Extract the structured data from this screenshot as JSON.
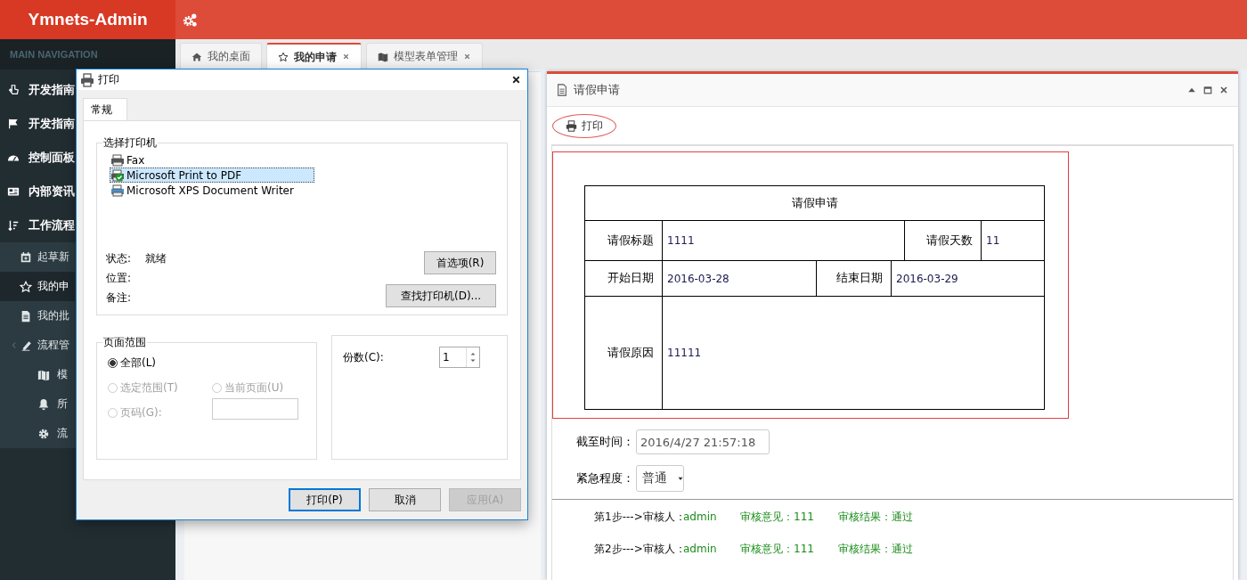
{
  "header": {
    "brand": "Ymnets-Admin"
  },
  "sidebar": {
    "heading": "MAIN NAVIGATION",
    "items": [
      {
        "label": "开发指南",
        "selected": false
      },
      {
        "label": "开发指南",
        "selected": false
      },
      {
        "label": "控制面板",
        "selected": false
      },
      {
        "label": "内部资讯",
        "selected": false
      },
      {
        "label": "工作流程",
        "selected": false,
        "expanded": true,
        "children": [
          {
            "label": "起草新",
            "selected": false
          },
          {
            "label": "我的申",
            "selected": true
          },
          {
            "label": "我的批",
            "selected": false
          },
          {
            "label": "流程管",
            "selected": false,
            "expanded": true,
            "children": [
              {
                "label": "模",
                "selected": false
              },
              {
                "label": "所",
                "selected": false
              },
              {
                "label": "流",
                "selected": false
              }
            ]
          }
        ]
      }
    ]
  },
  "tabs": [
    {
      "label": "我的桌面",
      "selected": false,
      "closable": false
    },
    {
      "label": "我的申请",
      "selected": true,
      "closable": true
    },
    {
      "label": "模型表单管理",
      "selected": false,
      "closable": true
    }
  ],
  "panel": {
    "title": "请假申请",
    "print_button": "打印",
    "form": {
      "title": "请假申请",
      "fields": [
        {
          "label": "请假标题",
          "value": "1111"
        },
        {
          "label": "请假天数",
          "value": "11"
        },
        {
          "label": "开始日期",
          "value": "2016-03-28"
        },
        {
          "label": "结束日期",
          "value": "2016-03-29"
        },
        {
          "label": "请假原因",
          "value": "11111"
        }
      ]
    },
    "deadline": {
      "label": "截至时间：",
      "value": "2016/4/27 21:57:18"
    },
    "urgency": {
      "label": "紧急程度：",
      "value": "普通"
    },
    "steps": [
      {
        "step": "第1步--->审核人：",
        "reviewer": "admin",
        "opinion_label": "审核意见：",
        "opinion": "111",
        "result_label": "审核结果：",
        "result": "通过"
      },
      {
        "step": "第2步--->审核人：",
        "reviewer": "admin",
        "opinion_label": "审核意见：",
        "opinion": "111",
        "result_label": "审核结果：",
        "result": "通过"
      }
    ]
  },
  "print_dialog": {
    "title": "打印",
    "tabs": [
      {
        "label": "常规",
        "selected": true
      }
    ],
    "printer_group": {
      "legend": "选择打印机",
      "printers": [
        {
          "name": "Fax",
          "selected": false,
          "default": false
        },
        {
          "name": "Microsoft Print to PDF",
          "selected": true,
          "default": true
        },
        {
          "name": "Microsoft XPS Document Writer",
          "selected": false,
          "default": false
        }
      ],
      "info": [
        {
          "label": "状态:",
          "value": "就绪"
        },
        {
          "label": "位置:"
        },
        {
          "label": "备注:"
        }
      ],
      "buttons": [
        "首选项(R)",
        "查找打印机(D)..."
      ]
    },
    "page_range": {
      "legend": "页面范围",
      "options": [
        {
          "label": "全部(L)",
          "selected": true,
          "disabled": false
        },
        {
          "label": "选定范围(T)",
          "selected": false,
          "disabled": true
        },
        {
          "label": "当前页面(U)",
          "selected": false,
          "disabled": true
        },
        {
          "label": "页码(G):",
          "selected": false,
          "disabled": true
        }
      ]
    },
    "copies": {
      "label": "份数(C):",
      "value": "1"
    },
    "buttons": [
      {
        "label": "打印(P)",
        "default": true,
        "disabled": false
      },
      {
        "label": "取消",
        "default": false,
        "disabled": false
      },
      {
        "label": "应用(A)",
        "default": false,
        "disabled": true
      }
    ]
  }
}
